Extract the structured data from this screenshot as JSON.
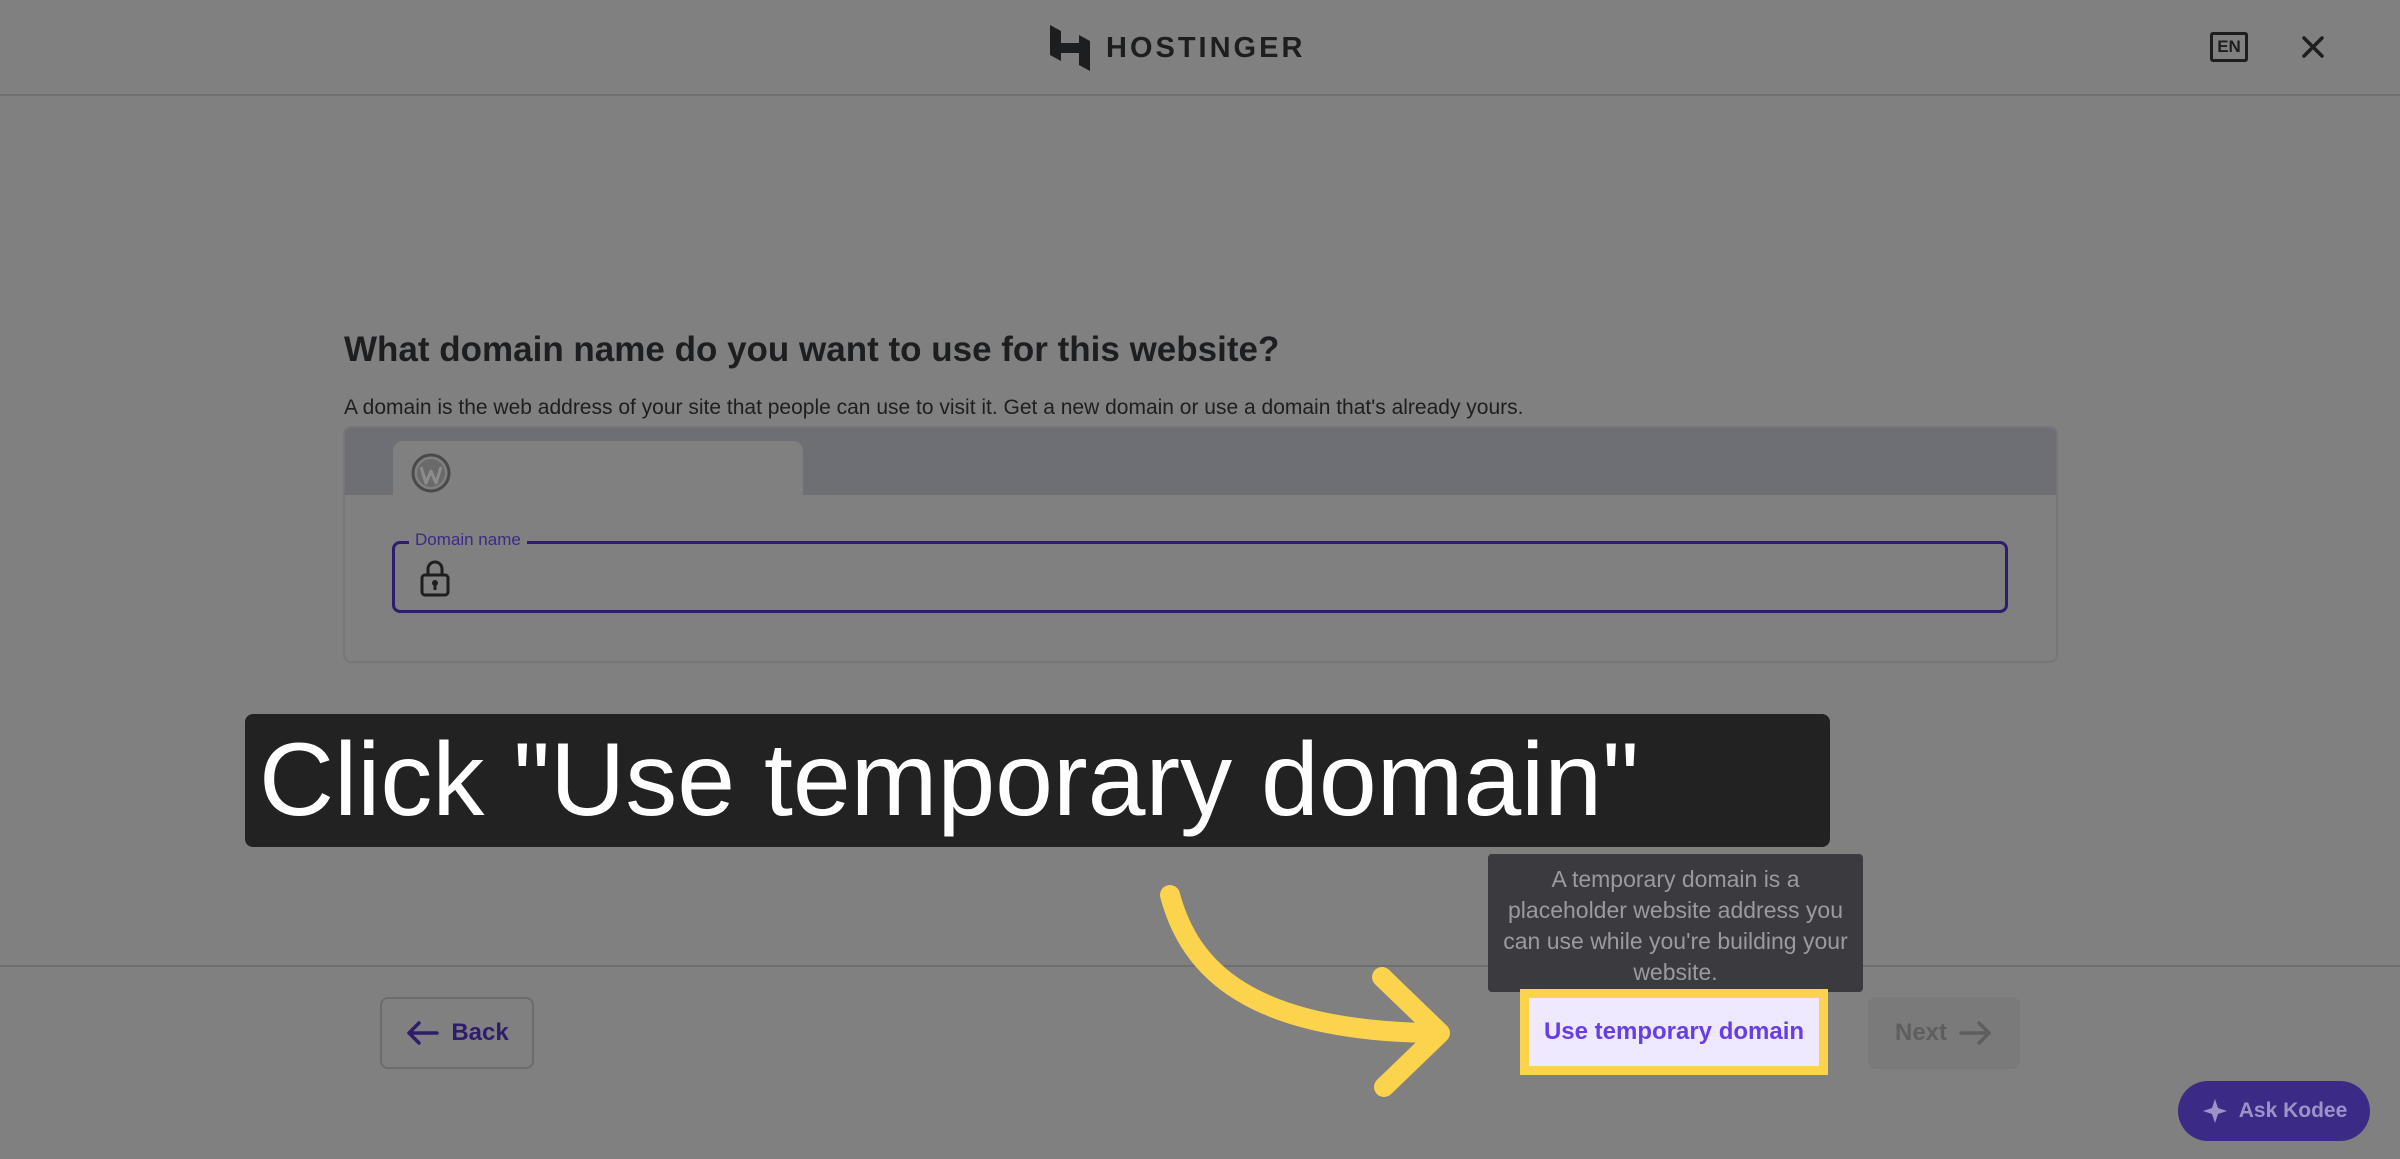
{
  "header": {
    "brand": "HOSTINGER",
    "language": "EN",
    "close_icon": "close-icon"
  },
  "main": {
    "title": "What domain name do you want to use for this website?",
    "subtitle": "A domain is the web address of your site that people can use to visit it. Get a new domain or use a domain that's already yours.",
    "tab_icon": "wordpress-icon",
    "field_label": "Domain name",
    "field_icon": "lock-icon",
    "field_value": ""
  },
  "tooltip": {
    "text": "A temporary domain is a placeholder website address you can use while you're building your website."
  },
  "footer": {
    "back_label": "Back",
    "temp_domain_label": "Use temporary domain",
    "next_label": "Next"
  },
  "annotation": {
    "instruction": "Click \"Use temporary domain\"",
    "highlight_color": "#fcd34d"
  },
  "assistant": {
    "label": "Ask Kodee"
  },
  "colors": {
    "overlay": "#808080",
    "accent": "#673de6",
    "dark_text": "#1d1e20"
  }
}
